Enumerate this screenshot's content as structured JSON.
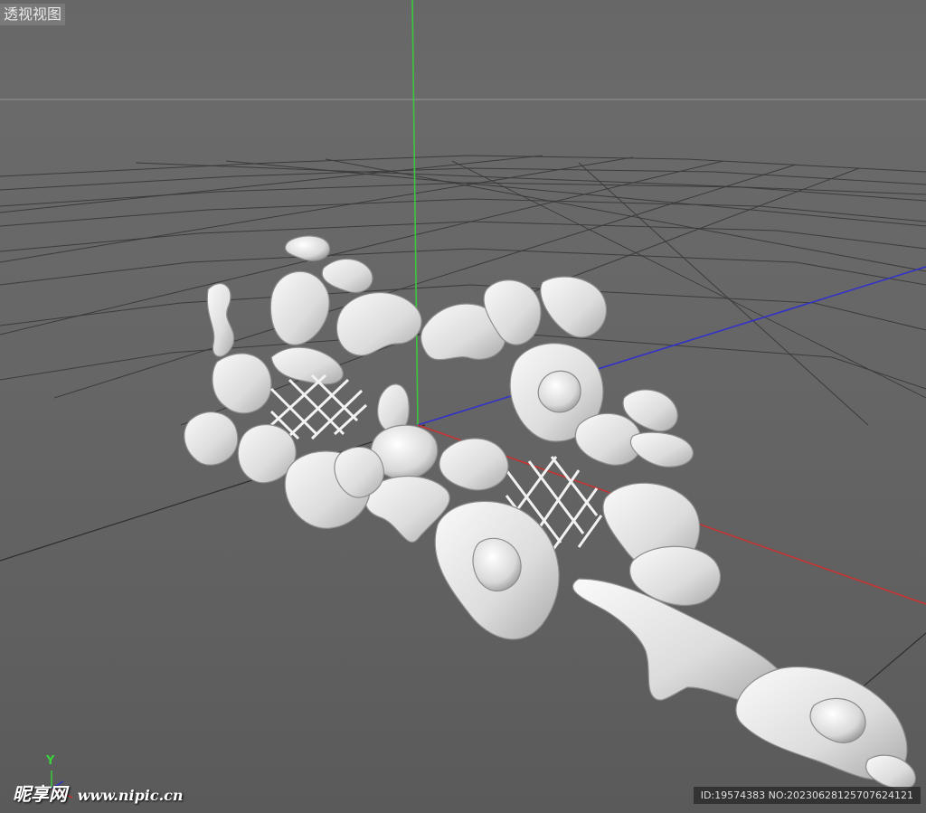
{
  "viewport": {
    "view_label": "透视视图",
    "axis_label_y": "Y",
    "model": "carved-scroll-ornament"
  },
  "watermark": {
    "brand": "昵享网",
    "site": "www.nipic.cn"
  },
  "image_id": {
    "text": "ID:19574383 NO:20230628125707624121"
  },
  "colors": {
    "background": "#666666",
    "grid": "#3a3a3a",
    "horizon": "#8a8a8a",
    "axis_x": "#c03030",
    "axis_y": "#3cc83c",
    "axis_z": "#3030c8",
    "model": "#e6e6e6"
  }
}
